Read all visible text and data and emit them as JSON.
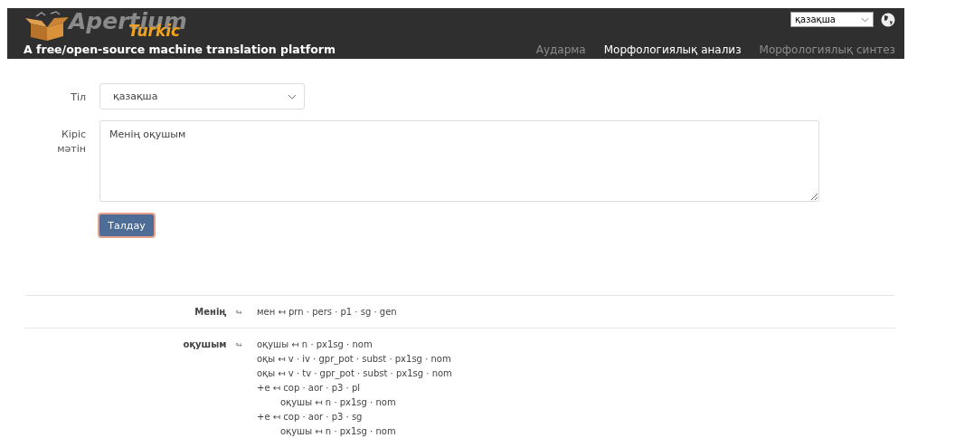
{
  "header": {
    "logo_text": "Apertium",
    "logo_subtext": "Turkic",
    "tagline": "A free/open-source machine translation platform",
    "locale_select": {
      "value": "қазақша"
    },
    "nav": [
      {
        "label": "Аударма",
        "selected": false
      },
      {
        "label": "Морфологиялық анализ",
        "selected": true
      },
      {
        "label": "Морфологиялық синтез",
        "selected": false
      }
    ]
  },
  "form": {
    "language_label": "Тіл",
    "language_select": {
      "value": "қазақша"
    },
    "input_label": "Кіріс мәтін",
    "input_text": "Менің оқушым",
    "submit": "Талдау"
  },
  "results": [
    {
      "word": "Менің",
      "link_symbol": "↬",
      "analyses": [
        {
          "text": "мен ↤ prn · pers · p1 · sg · gen"
        }
      ]
    },
    {
      "word": "оқушым",
      "link_symbol": "↬",
      "analyses": [
        {
          "text": "оқушы ↤ n · px1sg · nom"
        },
        {
          "text": "оқы ↤ v · iv · gpr_pot · subst · px1sg · nom"
        },
        {
          "text": "оқы ↤ v · tv · gpr_pot · subst · px1sg · nom"
        },
        {
          "text": "+е ↤ cop · aor · p3 · pl",
          "children": [
            {
              "text": "оқушы ↤ n · px1sg · nom"
            }
          ]
        },
        {
          "text": "+е ↤ cop · aor · p3 · sg",
          "children": [
            {
              "text": "оқушы ↤ n · px1sg · nom"
            }
          ]
        }
      ]
    }
  ]
}
